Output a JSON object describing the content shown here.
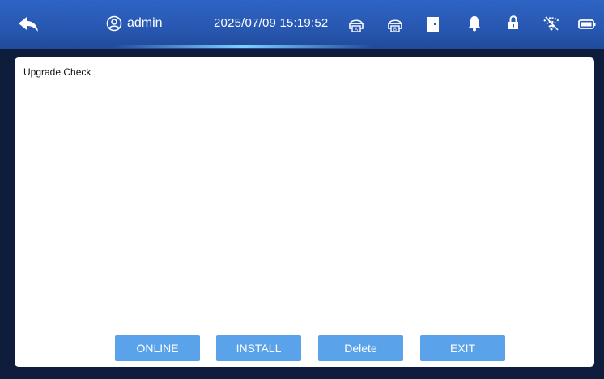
{
  "header": {
    "username": "admin",
    "datetime": "2025/07/09 15:19:52"
  },
  "icons": {
    "back": "back-arrow-icon",
    "user": "user-icon",
    "printer_a": "printer-a-icon",
    "printer_b": "printer-b-icon",
    "door": "door-icon",
    "bell": "bell-icon",
    "lock": "lock-icon",
    "wifi": "wifi-icon",
    "battery": "battery-icon"
  },
  "panel": {
    "title": "Upgrade Check"
  },
  "buttons": {
    "online": "ONLINE",
    "install": "INSTALL",
    "delete": "Delete",
    "exit": "EXIT"
  },
  "colors": {
    "header_bg": "#2757b0",
    "page_bg": "#0f1d3d",
    "button_bg": "#5aa3ea"
  }
}
